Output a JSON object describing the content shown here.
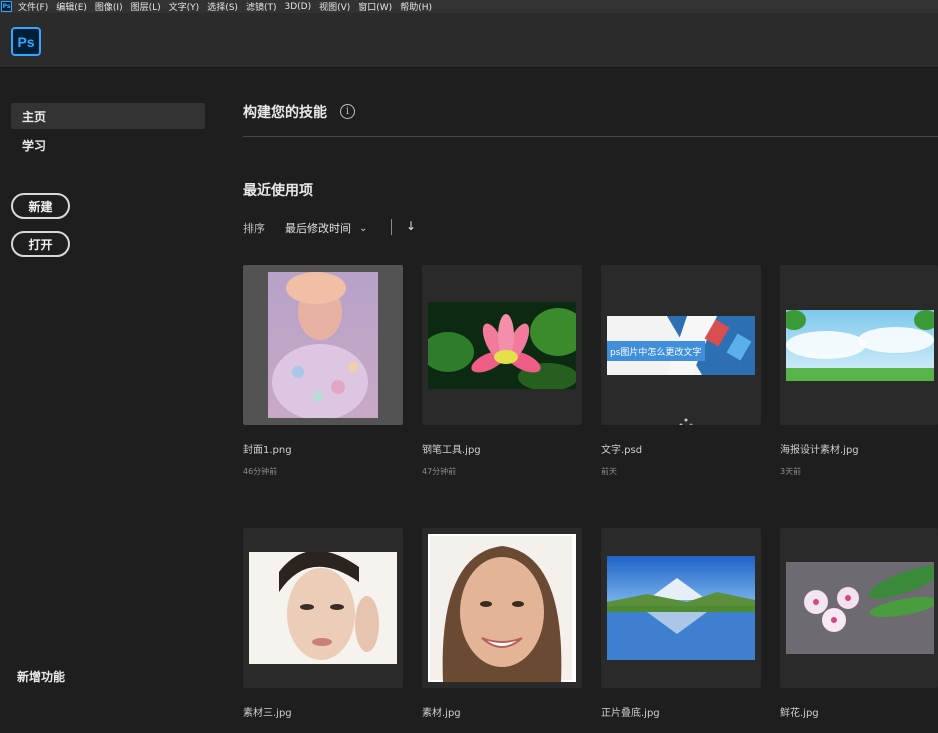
{
  "menu": [
    "文件(F)",
    "编辑(E)",
    "图像(I)",
    "图层(L)",
    "文字(Y)",
    "选择(S)",
    "滤镜(T)",
    "3D(D)",
    "视图(V)",
    "窗口(W)",
    "帮助(H)"
  ],
  "app": {
    "logo": "Ps",
    "mini_logo": "Ps"
  },
  "sidebar": {
    "home": "主页",
    "learn": "学习",
    "new_button": "新建",
    "open_button": "打开",
    "new_features": "新增功能"
  },
  "main": {
    "title": "构建您的技能",
    "info": "i",
    "recent_title": "最近使用项",
    "sort_label": "排序",
    "sort_value": "最后修改时间",
    "sort_chevron": "⌄",
    "sort_dir": "↓"
  },
  "files": [
    {
      "name": "封面1.png",
      "time": "46分钟前"
    },
    {
      "name": "钢笔工具.jpg",
      "time": "47分钟前"
    },
    {
      "name": "文字.psd",
      "time": "前天",
      "thumb_text": "ps图片中怎么更改文字"
    },
    {
      "name": "海报设计素材.jpg",
      "time": "3天前"
    },
    {
      "name": "素材三.jpg",
      "time": ""
    },
    {
      "name": "素材.jpg",
      "time": ""
    },
    {
      "name": "正片叠底.jpg",
      "time": ""
    },
    {
      "name": "鲜花.jpg",
      "time": ""
    }
  ],
  "colors": {
    "accent": "#31a8ff",
    "background": "#1e1e1e",
    "card": "#2a2a2a"
  }
}
